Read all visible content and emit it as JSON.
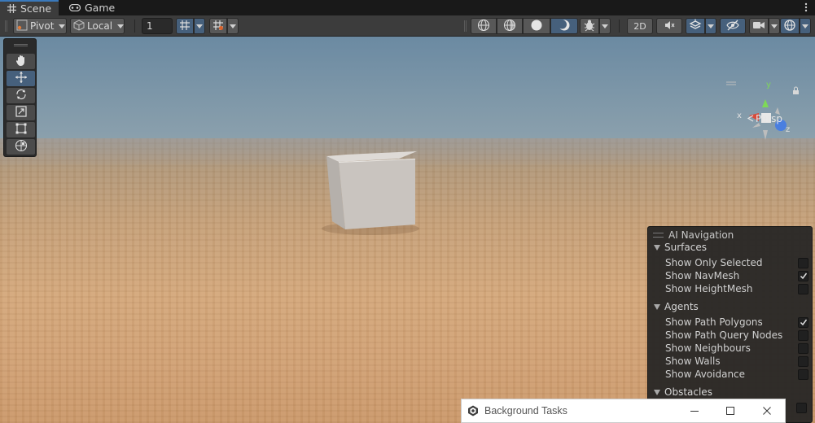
{
  "tabs": [
    {
      "label": "Scene",
      "icon": "grid-icon",
      "active": true
    },
    {
      "label": "Game",
      "icon": "gamepad-icon",
      "active": false
    }
  ],
  "toolbar": {
    "pivot_label": "Pivot",
    "local_label": "Local",
    "snap_value": "1",
    "twod_label": "2D"
  },
  "tools": [
    "hand-tool",
    "move-tool",
    "rotate-tool",
    "scale-tool",
    "rect-tool",
    "transform-tool"
  ],
  "gizmo": {
    "x_label": "x",
    "y_label": "y",
    "z_label": "z",
    "persp_label": "Persp"
  },
  "ai_navigation": {
    "title": "AI Navigation",
    "sections": [
      {
        "label": "Surfaces",
        "options": [
          {
            "label": "Show Only Selected",
            "checked": false
          },
          {
            "label": "Show NavMesh",
            "checked": true
          },
          {
            "label": "Show HeightMesh",
            "checked": false
          }
        ]
      },
      {
        "label": "Agents",
        "options": [
          {
            "label": "Show Path Polygons",
            "checked": true
          },
          {
            "label": "Show Path Query Nodes",
            "checked": false
          },
          {
            "label": "Show Neighbours",
            "checked": false
          },
          {
            "label": "Show Walls",
            "checked": false
          },
          {
            "label": "Show Avoidance",
            "checked": false
          }
        ]
      },
      {
        "label": "Obstacles",
        "options": []
      }
    ]
  },
  "background_tasks": {
    "title": "Background Tasks"
  },
  "colors": {
    "accent": "#3a79bb",
    "active_button": "#46607c"
  }
}
